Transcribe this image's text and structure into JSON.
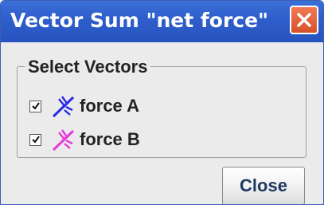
{
  "window": {
    "title": "Vector Sum \"net force\""
  },
  "group": {
    "legend": "Select Vectors",
    "vectors": [
      {
        "label": "force A",
        "checked": true,
        "icon": "vector-arrow-icon",
        "color": "#2a2ae6"
      },
      {
        "label": "force B",
        "checked": true,
        "icon": "vector-arrow-icon",
        "color": "#e63ad8"
      }
    ]
  },
  "buttons": {
    "close_label": "Close"
  }
}
